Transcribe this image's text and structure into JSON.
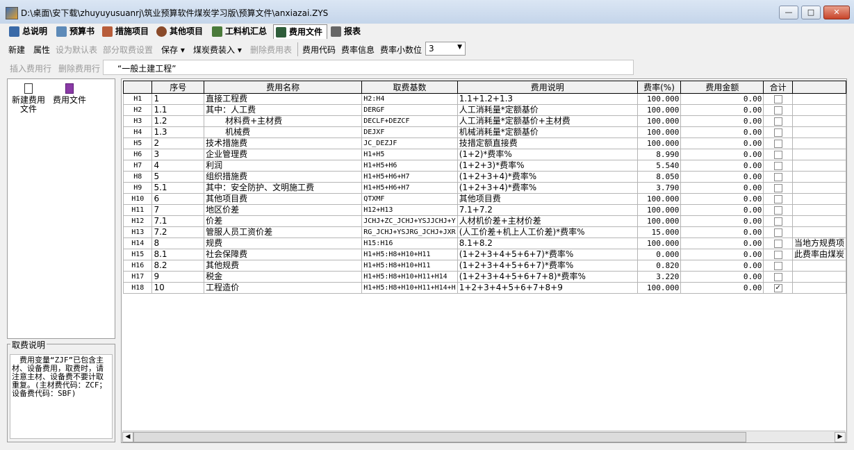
{
  "window": {
    "title": "D:\\桌面\\安下载\\zhuyuyusuanrj\\筑业预算软件煤炭学习版\\预算文件\\anxiazai.ZYS",
    "minimize": "—",
    "maximize": "□",
    "close": "✕"
  },
  "tabs": [
    {
      "label": "总说明",
      "icon": "book-icon"
    },
    {
      "label": "预算书",
      "icon": "calculator-icon"
    },
    {
      "label": "措施项目",
      "icon": "list-icon"
    },
    {
      "label": "其他项目",
      "icon": "gear-icon"
    },
    {
      "label": "工料机汇总",
      "icon": "worker-icon"
    },
    {
      "label": "费用文件",
      "icon": "ledger-icon"
    },
    {
      "label": "报表",
      "icon": "printer-icon"
    }
  ],
  "toolbar1": {
    "new": "新建",
    "props": "属性",
    "set_default": "设为默认表",
    "partial_fee": "部分取费设置",
    "save": "保存",
    "coal_load": "煤炭费装入",
    "delete_table": "删除费用表",
    "fee_code": "费用代码",
    "rate_info": "费率信息",
    "decimal_label": "费率小数位",
    "decimal_value": "3"
  },
  "toolbar2": {
    "insert_row": "插入费用行",
    "delete_row": "删除费用行",
    "project_name": "“一般土建工程”"
  },
  "left_panel": {
    "new_fee_line1": "新建费用",
    "new_fee_line2": "文件",
    "fee_file": "费用文件"
  },
  "fee_note": {
    "title": "取费说明",
    "text": "　费用变量“ZJF”已包含主材、设备费用，取费时，请注意主材、设备费不要计取重复。(主材费代码：ZCF；设备费代码：SBF)"
  },
  "grid": {
    "headers": [
      "",
      "序号",
      "费用名称",
      "取费基数",
      "费用说明",
      "费率(%)",
      "费用金额",
      "合计",
      ""
    ],
    "rows": [
      {
        "id": "H1",
        "no": "1",
        "name": "直接工程费",
        "base": "H2:H4",
        "desc": "1.1+1.2+1.3",
        "rate": "100.000",
        "amount": "0.00",
        "total": false,
        "extra": "",
        "indent": false
      },
      {
        "id": "H2",
        "no": "1.1",
        "name": "其中：人工费",
        "base": "DERGF",
        "desc": "人工消耗量*定额基价",
        "rate": "100.000",
        "amount": "0.00",
        "total": false,
        "extra": "",
        "indent": false
      },
      {
        "id": "H3",
        "no": "1.2",
        "name": "材料费+主材费",
        "base": "DECLF+DEZCF",
        "desc": "人工消耗量*定额基价+主材费",
        "rate": "100.000",
        "amount": "0.00",
        "total": false,
        "extra": "",
        "indent": true
      },
      {
        "id": "H4",
        "no": "1.3",
        "name": "机械费",
        "base": "DEJXF",
        "desc": "机械消耗量*定额基价",
        "rate": "100.000",
        "amount": "0.00",
        "total": false,
        "extra": "",
        "indent": true
      },
      {
        "id": "H5",
        "no": "2",
        "name": "技术措施费",
        "base": "JC_DEZJF",
        "desc": "技措定额直接费",
        "rate": "100.000",
        "amount": "0.00",
        "total": false,
        "extra": "",
        "indent": false
      },
      {
        "id": "H6",
        "no": "3",
        "name": "企业管理费",
        "base": "H1+H5",
        "desc": "(1+2)*费率%",
        "rate": "8.990",
        "amount": "0.00",
        "total": false,
        "extra": "",
        "indent": false
      },
      {
        "id": "H7",
        "no": "4",
        "name": "利润",
        "base": "H1+H5+H6",
        "desc": "(1+2+3)*费率%",
        "rate": "5.540",
        "amount": "0.00",
        "total": false,
        "extra": "",
        "indent": false
      },
      {
        "id": "H8",
        "no": "5",
        "name": "组织措施费",
        "base": "H1+H5+H6+H7",
        "desc": "(1+2+3+4)*费率%",
        "rate": "8.050",
        "amount": "0.00",
        "total": false,
        "extra": "",
        "indent": false
      },
      {
        "id": "H9",
        "no": "5.1",
        "name": "其中：安全防护、文明施工费",
        "base": "H1+H5+H6+H7",
        "desc": "(1+2+3+4)*费率%",
        "rate": "3.790",
        "amount": "0.00",
        "total": false,
        "extra": "",
        "indent": false
      },
      {
        "id": "H10",
        "no": "6",
        "name": "其他项目费",
        "base": "QTXMF",
        "desc": "其他项目费",
        "rate": "100.000",
        "amount": "0.00",
        "total": false,
        "extra": "",
        "indent": false
      },
      {
        "id": "H11",
        "no": "7",
        "name": "地区价差",
        "base": "H12+H13",
        "desc": "7.1+7.2",
        "rate": "100.000",
        "amount": "0.00",
        "total": false,
        "extra": "",
        "indent": false
      },
      {
        "id": "H12",
        "no": "7.1",
        "name": "价差",
        "base": "JCHJ+ZC_JCHJ+YSJJCHJ+Y",
        "desc": "人材机价差+主材价差",
        "rate": "100.000",
        "amount": "0.00",
        "total": false,
        "extra": "",
        "indent": false
      },
      {
        "id": "H13",
        "no": "7.2",
        "name": "管服人员工资价差",
        "base": "RG_JCHJ+YSJRG_JCHJ+JXR",
        "desc": "(人工价差+机上人工价差)*费率%",
        "rate": "15.000",
        "amount": "0.00",
        "total": false,
        "extra": "",
        "indent": false
      },
      {
        "id": "H14",
        "no": "8",
        "name": "规费",
        "base": "H15:H16",
        "desc": "8.1+8.2",
        "rate": "100.000",
        "amount": "0.00",
        "total": false,
        "extra": "当地方规费项",
        "indent": false
      },
      {
        "id": "H15",
        "no": "8.1",
        "name": "社会保障费",
        "base": "H1+H5:H8+H10+H11",
        "desc": "(1+2+3+4+5+6+7)*费率%",
        "rate": "0.000",
        "amount": "0.00",
        "total": false,
        "extra": "此费率由煤炭",
        "indent": false
      },
      {
        "id": "H16",
        "no": "8.2",
        "name": "其他规费",
        "base": "H1+H5:H8+H10+H11",
        "desc": "(1+2+3+4+5+6+7)*费率%",
        "rate": "0.820",
        "amount": "0.00",
        "total": false,
        "extra": "",
        "indent": false
      },
      {
        "id": "H17",
        "no": "9",
        "name": "税金",
        "base": "H1+H5:H8+H10+H11+H14",
        "desc": "(1+2+3+4+5+6+7+8)*费率%",
        "rate": "3.220",
        "amount": "0.00",
        "total": false,
        "extra": "",
        "indent": false
      },
      {
        "id": "H18",
        "no": "10",
        "name": "工程造价",
        "base": "H1+H5:H8+H10+H11+H14+H",
        "desc": "1+2+3+4+5+6+7+8+9",
        "rate": "100.000",
        "amount": "0.00",
        "total": true,
        "extra": "",
        "indent": false
      }
    ]
  },
  "scroll": {
    "left": "◀",
    "right": "▶"
  }
}
